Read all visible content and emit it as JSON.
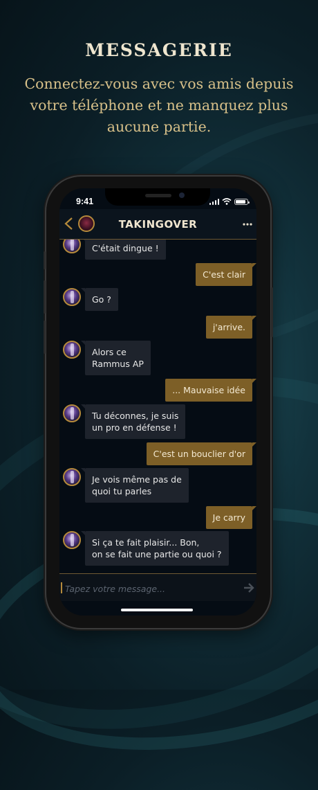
{
  "promo": {
    "headline": "MESSAGERIE",
    "subline": "Connectez-vous avec vos amis depuis votre téléphone et ne manquez plus aucune partie."
  },
  "status_bar": {
    "time": "9:41"
  },
  "chat": {
    "title": "TAKINGOVER",
    "input_placeholder": "Tapez votre message...",
    "messages": [
      {
        "from": "them",
        "text": "C'était dingue !"
      },
      {
        "from": "me",
        "text": "C'est clair"
      },
      {
        "from": "them",
        "text": "Go ?"
      },
      {
        "from": "me",
        "text": "j'arrive."
      },
      {
        "from": "them",
        "text": "Alors ce\nRammus AP"
      },
      {
        "from": "me",
        "text": "... Mauvaise idée"
      },
      {
        "from": "them",
        "text": "Tu déconnes, je suis\nun pro en défense !"
      },
      {
        "from": "me",
        "text": "C'est un bouclier d'or"
      },
      {
        "from": "them",
        "text": "Je vois même pas de\nquoi tu parles"
      },
      {
        "from": "me",
        "text": "Je carry"
      },
      {
        "from": "them",
        "text": "Si ça te fait plaisir... Bon,\non se fait une partie ou quoi ?"
      }
    ]
  },
  "colors": {
    "gold": "#b58a3b",
    "sent_bubble": "#7d5f27",
    "received_bubble": "#1e232c",
    "screen_bg": "#050c14"
  },
  "icons": [
    "back-chevron-icon",
    "more-dots-icon",
    "send-icon",
    "signal-icon",
    "wifi-icon",
    "battery-icon"
  ]
}
